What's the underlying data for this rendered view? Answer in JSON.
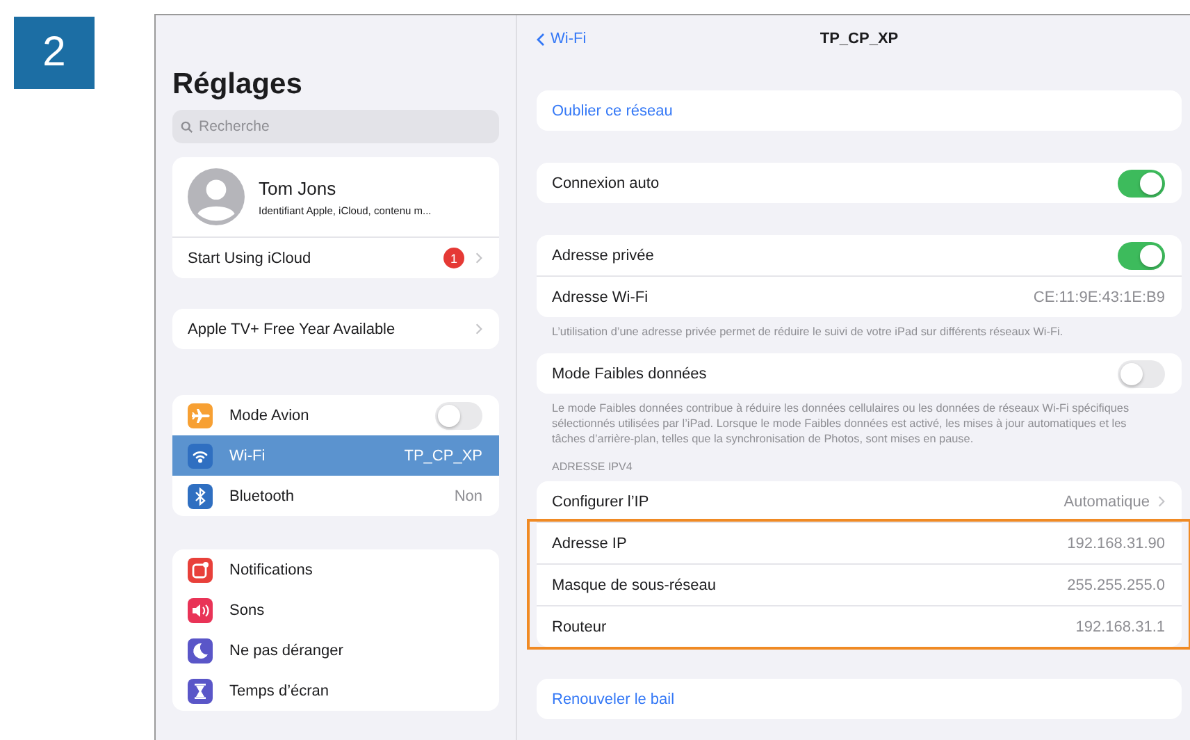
{
  "step_badge": "2",
  "sidebar": {
    "title": "Réglages",
    "search": {
      "placeholder": "Recherche"
    },
    "account": {
      "name": "Tom Jons",
      "subtitle": "Identifiant Apple, iCloud, contenu m...",
      "rows": [
        {
          "label": "Start Using iCloud",
          "badge": "1"
        }
      ]
    },
    "promo": {
      "label": "Apple TV+ Free Year Available"
    },
    "groups": [
      {
        "items": [
          {
            "kind": "toggle",
            "label": "Mode Avion",
            "color": "#f7a033",
            "on": false,
            "selected": false
          },
          {
            "kind": "value",
            "label": "Wi-Fi",
            "value": "TP_CP_XP",
            "color": "#2f6fc1",
            "selected": true
          },
          {
            "kind": "value",
            "label": "Bluetooth",
            "value": "Non",
            "color": "#2f6fc1",
            "selected": false
          }
        ]
      },
      {
        "items": [
          {
            "kind": "plain",
            "label": "Notifications",
            "color": "#e8403a",
            "selected": false
          },
          {
            "kind": "plain",
            "label": "Sons",
            "color": "#e93357",
            "selected": false
          },
          {
            "kind": "plain",
            "label": "Ne pas déranger",
            "color": "#5a56c8",
            "selected": false
          },
          {
            "kind": "plain",
            "label": "Temps d’écran",
            "color": "#5a56c8",
            "selected": false
          }
        ]
      }
    ]
  },
  "detail": {
    "back": "Wi-Fi",
    "title": "TP_CP_XP",
    "sections": [
      {
        "rows": [
          {
            "kind": "action",
            "label": "Oublier ce réseau"
          }
        ]
      },
      {
        "rows": [
          {
            "kind": "toggle",
            "label": "Connexion auto",
            "on": true
          }
        ]
      },
      {
        "rows": [
          {
            "kind": "toggle",
            "label": "Adresse privée",
            "on": true
          },
          {
            "kind": "value",
            "label": "Adresse Wi-Fi",
            "value": "CE:11:9E:43:1E:B9"
          }
        ],
        "footer": "L’utilisation d’une adresse privée permet de réduire le suivi de votre iPad sur différents réseaux Wi-Fi."
      },
      {
        "rows": [
          {
            "kind": "toggle",
            "label": "Mode Faibles données",
            "on": false
          }
        ],
        "footer": "Le mode Faibles données contribue à réduire les données cellulaires ou les données de réseaux Wi-Fi spécifiques sélectionnés utilisées par l’iPad. Lorsque le mode Faibles données est activé, les mises à jour automatiques et les tâches d’arrière-plan, telles que la synchronisation de Photos, sont mises en pause."
      },
      {
        "header": "ADRESSE IPV4",
        "rows": [
          {
            "kind": "link",
            "label": "Configurer l’IP",
            "value": "Automatique"
          }
        ],
        "highlighted_rows": [
          {
            "kind": "value",
            "label": "Adresse IP",
            "value": "192.168.31.90"
          },
          {
            "kind": "value",
            "label": "Masque de sous-réseau",
            "value": "255.255.255.0"
          },
          {
            "kind": "value",
            "label": "Routeur",
            "value": "192.168.31.1"
          }
        ]
      },
      {
        "rows": [
          {
            "kind": "action",
            "label": "Renouveler le bail"
          }
        ]
      }
    ]
  }
}
